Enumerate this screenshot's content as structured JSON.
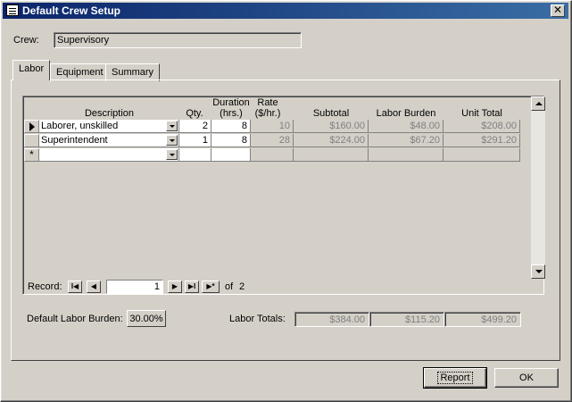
{
  "window": {
    "title": "Default Crew Setup",
    "close_glyph": "✕"
  },
  "crew": {
    "label": "Crew:",
    "value": "Supervisory"
  },
  "tabs": [
    {
      "label": "Labor"
    },
    {
      "label": "Equipment"
    },
    {
      "label": "Summary"
    }
  ],
  "grid": {
    "headers": {
      "description": "Description",
      "qty": "Qty.",
      "duration": "Duration (hrs.)",
      "rate": "Rate ($/hr.)",
      "subtotal": "Subtotal",
      "labor_burden": "Labor Burden",
      "unit_total": "Unit Total"
    },
    "rows": [
      {
        "description": "Laborer, unskilled",
        "qty": "2",
        "duration": "8",
        "rate": "10",
        "subtotal": "$160.00",
        "labor_burden": "$48.00",
        "unit_total": "$208.00"
      },
      {
        "description": "Superintendent",
        "qty": "1",
        "duration": "8",
        "rate": "28",
        "subtotal": "$224.00",
        "labor_burden": "$67.20",
        "unit_total": "$291.20"
      }
    ],
    "new_row_glyph": "*"
  },
  "record_nav": {
    "label": "Record:",
    "current": "1",
    "of_label": "of",
    "total": "2"
  },
  "default_labor_burden": {
    "label": "Default Labor Burden:",
    "value": "30.00%"
  },
  "labor_totals": {
    "label": "Labor Totals:",
    "subtotal": "$384.00",
    "labor_burden": "$115.20",
    "unit_total": "$499.20"
  },
  "buttons": {
    "report": "Report",
    "ok": "OK"
  }
}
